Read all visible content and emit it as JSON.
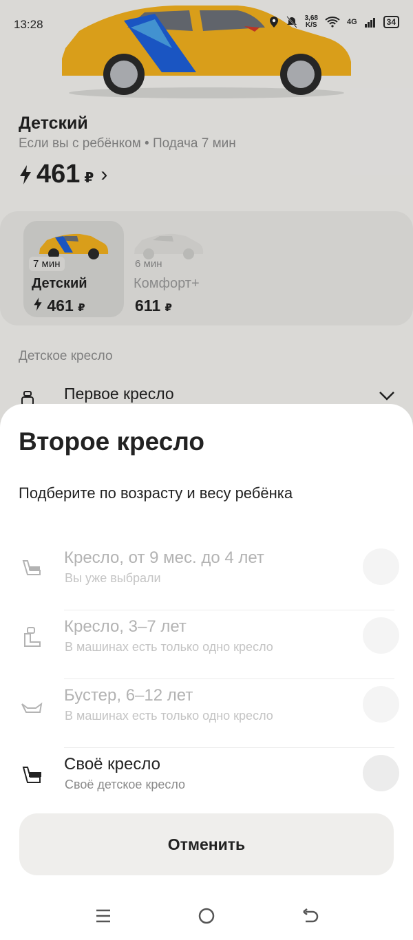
{
  "status_bar": {
    "time": "13:28",
    "net_speed_value": "3,68",
    "net_speed_unit": "K/S",
    "network": "4G",
    "battery": "34",
    "icons": [
      "location-icon",
      "bell-off-icon",
      "wifi-icon",
      "signal-icon",
      "battery-icon"
    ]
  },
  "tariff": {
    "title": "Детский",
    "subtitle": "Если вы с ребёнком • Подача 7 мин",
    "price": "461",
    "currency": "₽"
  },
  "cards": [
    {
      "eta": "7 мин",
      "name": "Детский",
      "price": "461",
      "currency": "₽",
      "selected": true
    },
    {
      "eta": "6 мин",
      "name": "Комфорт+",
      "price": "611",
      "currency": "₽",
      "selected": false
    }
  ],
  "child_seat": {
    "section_label": "Детское кресло",
    "first_seat": "Первое кресло"
  },
  "sheet": {
    "title": "Второе кресло",
    "subtitle": "Подберите по возрасту и весу ребёнка",
    "options": [
      {
        "title": "Кресло, от 9 мес. до 4 лет",
        "desc": "Вы уже выбрали",
        "enabled": false,
        "icon": "infant-seat-icon"
      },
      {
        "title": "Кресло, 3–7 лет",
        "desc": "В машинах есть только одно кресло",
        "enabled": false,
        "icon": "child-seat-icon"
      },
      {
        "title": "Бустер, 6–12 лет",
        "desc": "В машинах есть только одно кресло",
        "enabled": false,
        "icon": "booster-icon"
      },
      {
        "title": "Своё кресло",
        "desc": "Своё детское кресло",
        "enabled": true,
        "icon": "own-seat-icon"
      }
    ],
    "cancel_label": "Отменить"
  },
  "nav": {
    "icons": [
      "menu-icon",
      "home-icon",
      "back-icon"
    ]
  },
  "colors": {
    "taxi_yellow": "#f2b01e",
    "accent_blue": "#1e5fd8",
    "text_primary": "#222222",
    "text_secondary": "#8a8a8a"
  }
}
